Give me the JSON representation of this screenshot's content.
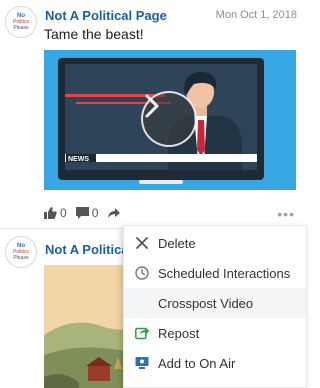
{
  "posts": [
    {
      "avatar": {
        "line1": "No",
        "line2": "Politics",
        "line3": "Please"
      },
      "page_name": "Not A Political Page",
      "timestamp": "Mon Oct 1, 2018",
      "text": "Tame the beast!",
      "video_overlay_text": "NEWS",
      "likes": "0",
      "comments": "0"
    },
    {
      "avatar": {
        "line1": "No",
        "line2": "Politics",
        "line3": "Please"
      },
      "page_name": "Not A Political"
    }
  ],
  "more_menu": {
    "items": [
      {
        "label": "Delete",
        "icon": "x-icon"
      },
      {
        "label": "Scheduled Interactions",
        "icon": "clock-icon"
      },
      {
        "label": "Crosspost Video",
        "icon": null
      },
      {
        "label": "Repost",
        "icon": "repost-icon"
      },
      {
        "label": "Add to On Air",
        "icon": "on-air-icon"
      }
    ]
  },
  "colors": {
    "link": "#1b5fa8",
    "video_bg": "#37a7e3",
    "repost_green": "#2a9d4b",
    "on_air_blue": "#2f6fb7"
  }
}
